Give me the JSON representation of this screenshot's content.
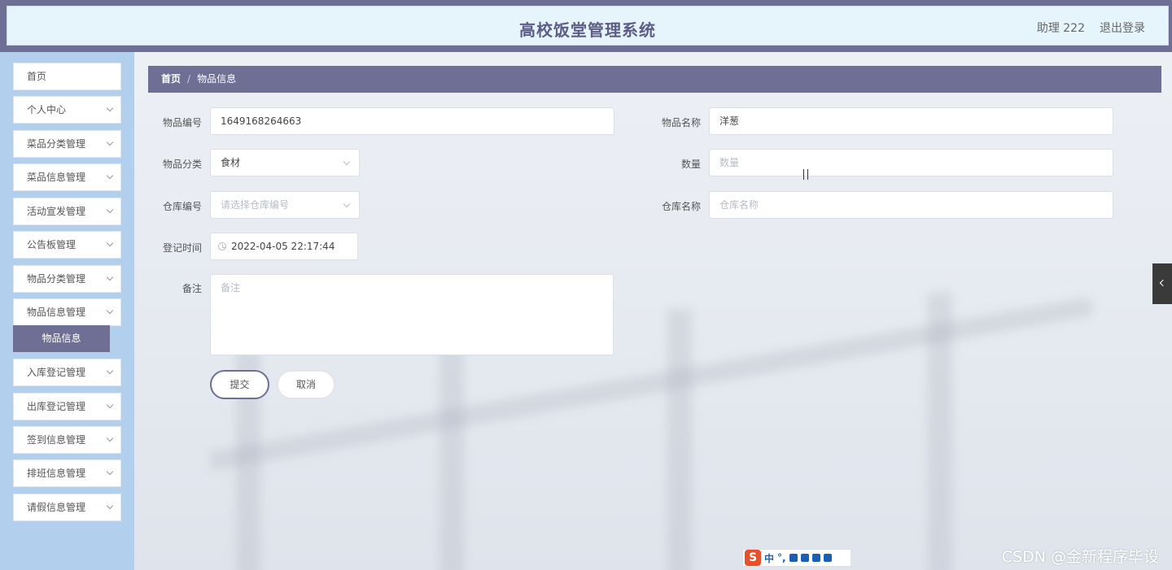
{
  "header": {
    "title": "高校饭堂管理系统",
    "user": "助理 222",
    "logout": "退出登录"
  },
  "sidebar": {
    "items": [
      {
        "label": "首页",
        "has_chevron": false
      },
      {
        "label": "个人中心",
        "has_chevron": true
      },
      {
        "label": "菜品分类管理",
        "has_chevron": true
      },
      {
        "label": "菜品信息管理",
        "has_chevron": true
      },
      {
        "label": "活动宣发管理",
        "has_chevron": true
      },
      {
        "label": "公告板管理",
        "has_chevron": true
      },
      {
        "label": "物品分类管理",
        "has_chevron": true
      },
      {
        "label": "物品信息管理",
        "has_chevron": true
      },
      {
        "label": "入库登记管理",
        "has_chevron": true
      },
      {
        "label": "出库登记管理",
        "has_chevron": true
      },
      {
        "label": "签到信息管理",
        "has_chevron": true
      },
      {
        "label": "排班信息管理",
        "has_chevron": true
      },
      {
        "label": "请假信息管理",
        "has_chevron": true
      }
    ],
    "active_submenu": "物品信息"
  },
  "breadcrumb": {
    "home": "首页",
    "separator": "/",
    "current": "物品信息"
  },
  "form": {
    "item_code": {
      "label": "物品编号",
      "value": "1649168264663"
    },
    "item_name": {
      "label": "物品名称",
      "value": "洋葱"
    },
    "item_category": {
      "label": "物品分类",
      "value": "食材"
    },
    "quantity": {
      "label": "数量",
      "placeholder": "数量"
    },
    "warehouse_code": {
      "label": "仓库编号",
      "placeholder": "请选择仓库编号"
    },
    "warehouse_name": {
      "label": "仓库名称",
      "placeholder": "仓库名称"
    },
    "register_time": {
      "label": "登记时间",
      "value": "2022-04-05 22:17:44"
    },
    "remark": {
      "label": "备注",
      "placeholder": "备注"
    },
    "submit": "提交",
    "cancel": "取消"
  },
  "ime": {
    "logo": "S",
    "mode": "中",
    "punct": "°,"
  },
  "watermark": "CSDN @金新程序毕设",
  "colors": {
    "primary": "#6f6e94",
    "sidebar_bg": "#b3cfee",
    "header_bg": "#e6f4fc"
  }
}
